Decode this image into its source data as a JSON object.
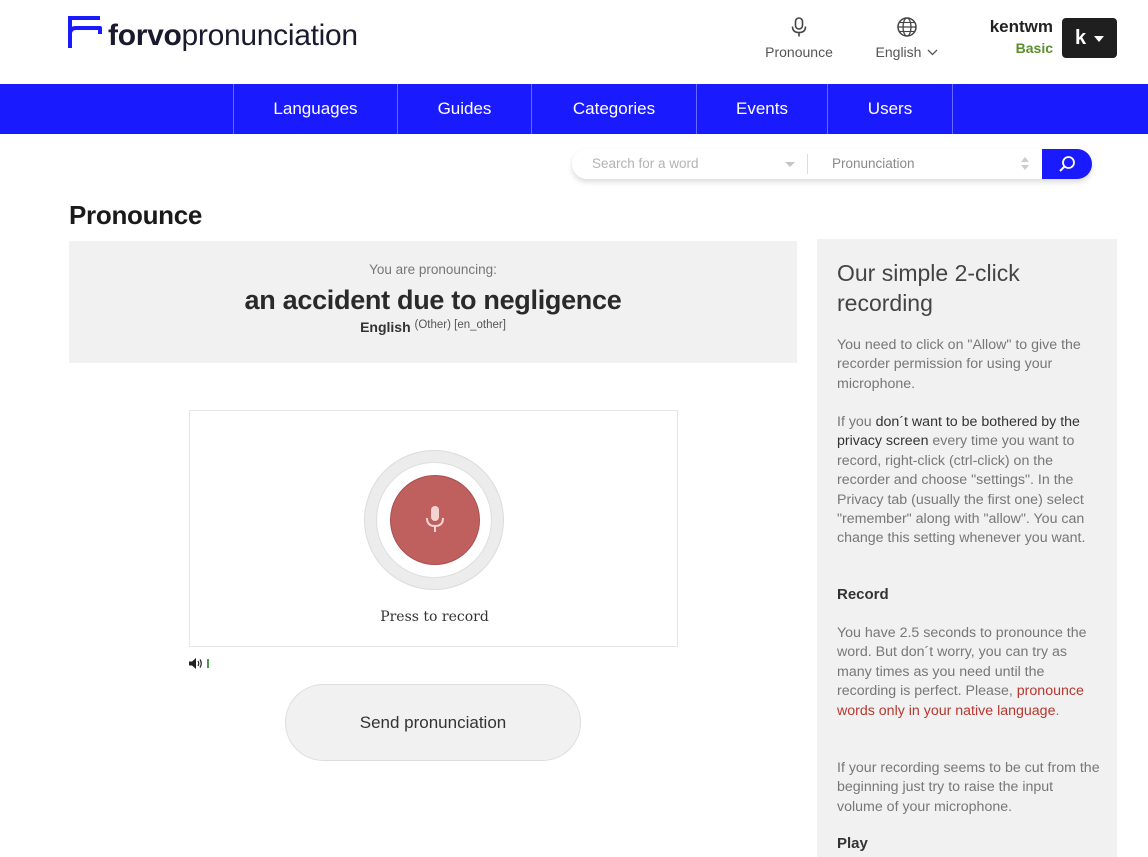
{
  "brand": {
    "name_bold": "forvo",
    "name_light": "pronunciation",
    "color": "#1a1aff"
  },
  "header": {
    "pronounce_label": "Pronounce",
    "language_label": "English",
    "username": "kentwm",
    "plan": "Basic",
    "avatar_letter": "k"
  },
  "nav": {
    "items": [
      "Languages",
      "Guides",
      "Categories",
      "Events",
      "Users"
    ]
  },
  "search": {
    "placeholder": "Search for a word",
    "select_value": "Pronunciation"
  },
  "page_title": "Pronounce",
  "pronouncing": {
    "subtitle": "You are pronouncing:",
    "word": "an accident due to negligence",
    "language": "English",
    "variant": "(Other) [en_other]"
  },
  "recorder": {
    "label": "Press to record"
  },
  "send_label": "Send pronunciation",
  "sidebar": {
    "title": "Our simple 2-click recording",
    "p1": "You need to click on \"Allow\" to give the recorder permission for using your microphone.",
    "p2_pre": "If you ",
    "p2_bold": "don´t want to be bothered by the privacy screen",
    "p2_post": " every time you want to record, right-click (ctrl-click) on the recorder and choose \"settings\". In the Privacy tab (usually the first one) select \"remember\" along with \"allow\". You can change this setting whenever you want.",
    "record_head": "Record",
    "p3_pre": "You have 2.5 seconds to pronounce the word. But don´t worry, you can try as many times as you need until the recording is perfect. Please, ",
    "p3_link": "pronounce words only in your native language",
    "p3_post": ".",
    "p4": "If your recording seems to be cut from the beginning just try to raise the input volume of your microphone.",
    "play_head": "Play"
  }
}
